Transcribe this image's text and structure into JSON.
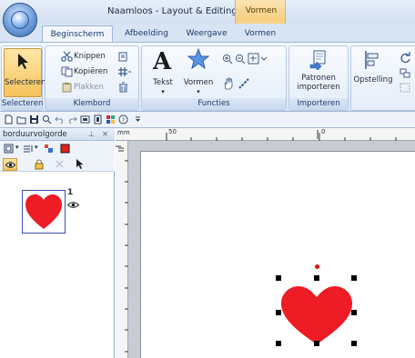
{
  "window": {
    "title": "Naamloos - Layout & Editing",
    "context_tab": "Vormen"
  },
  "tabs": [
    {
      "label": "Beginscherm",
      "active": true
    },
    {
      "label": "Afbeelding",
      "active": false
    },
    {
      "label": "Weergave",
      "active": false
    },
    {
      "label": "Vormen",
      "active": false
    }
  ],
  "ribbon": {
    "selecteren": {
      "button": "Selecteren",
      "group": "Selecteren"
    },
    "klembord": {
      "cut": "Knippen",
      "copy": "Kopiëren",
      "paste": "Plakken",
      "group": "Klembord"
    },
    "functies": {
      "text": "Tekst",
      "shapes": "Vormen",
      "group": "Functies"
    },
    "importeren": {
      "button_line1": "Patronen",
      "button_line2": "importeren",
      "group": "Importeren"
    },
    "arrange": {
      "button": "Opstelling"
    }
  },
  "panel": {
    "title": "borduurvolgorde",
    "pin": " ɨ",
    "close": "×",
    "item": {
      "number": "1"
    }
  },
  "ruler": {
    "unit": "mm",
    "marks": [
      "50",
      "0"
    ]
  },
  "colors": {
    "accent": "#f7c35c",
    "heart": "#ee1c25",
    "thread": "#e0231e",
    "selection": "#e01010"
  },
  "icons": {
    "heart": "heart",
    "eye": "eye-icon",
    "lock": "lock-icon",
    "cursor": "cursor-icon"
  }
}
